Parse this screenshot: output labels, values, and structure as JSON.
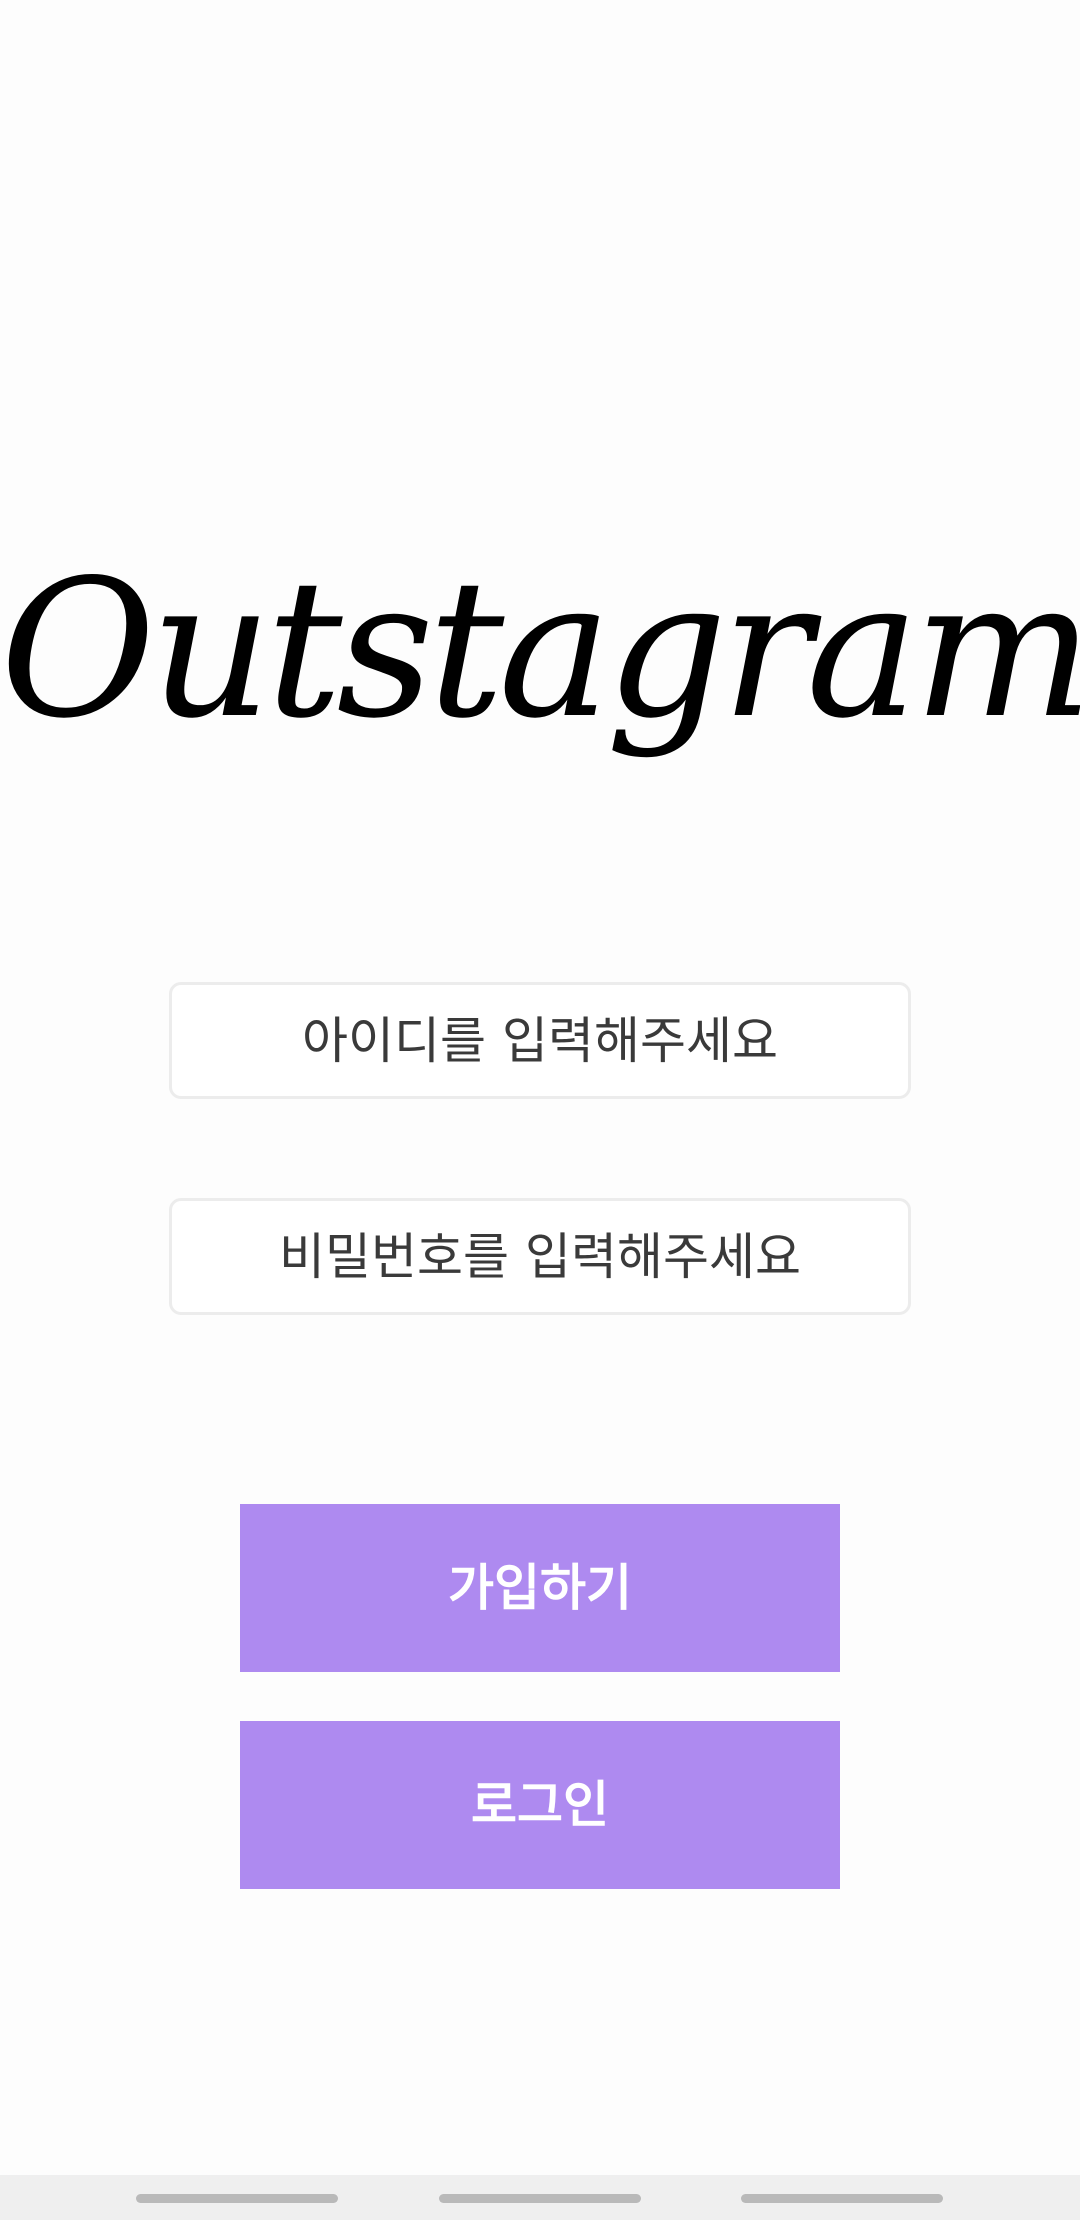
{
  "app": {
    "logo_text": "Outstagram"
  },
  "form": {
    "id_placeholder": "아이디를 입력해주세요",
    "password_placeholder": "비밀번호를 입력해주세요"
  },
  "actions": {
    "signup_label": "가입하기",
    "login_label": "로그인"
  },
  "colors": {
    "background": "#fdfdfd",
    "button_primary": "#ae8af0",
    "button_text": "#ffffff",
    "field_border": "#ececec",
    "navbar_background": "#efefef",
    "nav_handle": "#b9b9b9"
  },
  "navigation": {
    "handles": [
      "nav-handle-left",
      "nav-handle-center",
      "nav-handle-right"
    ]
  }
}
